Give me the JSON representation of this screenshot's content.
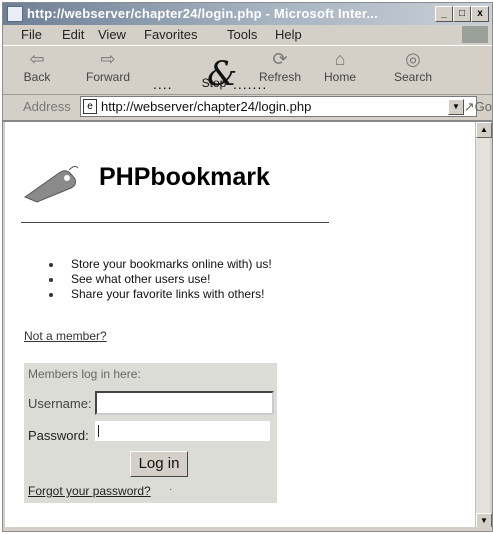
{
  "window": {
    "title": "http://webserver/chapter24/login.php - Microsoft Inter...",
    "controls": {
      "minimize": "_",
      "maximize": "□",
      "close": "x"
    }
  },
  "menu": [
    "File",
    "Edit",
    "View",
    "Favorites",
    "Tools",
    "Help"
  ],
  "toolbar": {
    "back": "Back",
    "forward": "Forward",
    "stop": "Stop",
    "refresh": "Refresh",
    "home": "Home",
    "search": "Search",
    "ampersand": "&",
    "dots_left": "....",
    "dots_right": "......."
  },
  "address": {
    "label": "Address",
    "url": "http://webserver/chapter24/login.php",
    "go": "Go"
  },
  "page": {
    "brand": "PHPbookmark",
    "features": [
      "Store your bookmarks online with) us!",
      "See what other users use!",
      "Share your favorite links with others!"
    ],
    "not_member": "Not a member?",
    "login": {
      "title": "Members log in here:",
      "username_label": "Username:",
      "password_label": "Password:",
      "submit": "Log in",
      "forgot": "Forgot your password?",
      "forgot_mark": "·"
    }
  }
}
